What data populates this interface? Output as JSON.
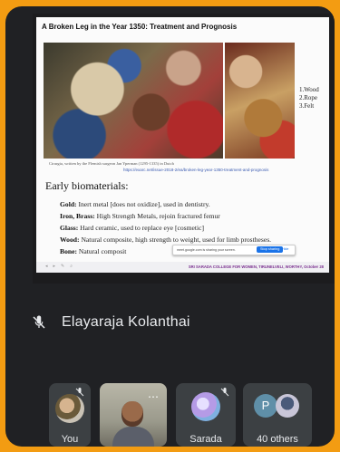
{
  "slide": {
    "title": "A Broken Leg in the Year 1350: Treatment and Prognosis",
    "legend": [
      "1.Wood",
      "2.Rope",
      "3.Felt"
    ],
    "caption": "Cirurgia, written by the Flemish surgeon Jan Yperman (1295-1335) in Dutch",
    "link": "https://exarc.net/issue-2018-2/ea/broken-leg-year-1350-treatment-and-prognosis",
    "heading": "Early biomaterials:",
    "materials": [
      {
        "name": "Gold:",
        "desc": "Inert metal [does not oxidize], used in dentistry."
      },
      {
        "name": "Iron, Brass:",
        "desc": "High Strength Metals, rejoin fractured femur"
      },
      {
        "name": "Glass:",
        "desc": "Hard ceramic, used to replace eye [cosmetic]"
      },
      {
        "name": "Wood:",
        "desc": "Natural composite, high strength to weight, used for limb prostheses."
      },
      {
        "name": "Bone:",
        "desc": "Natural composit"
      }
    ],
    "share_notice": "meet.google.com is sharing your screen.",
    "stop_sharing": "Stop sharing",
    "hide": "Hide",
    "footer": "SRI SARADA COLLEGE FOR WOMEN, TIRUNELVELI, WORTHY, October 28"
  },
  "presenter": {
    "name": "Elayaraja Kolanthai",
    "icon": "mic-off-icon"
  },
  "tiles": [
    {
      "label": "You",
      "icon": "mic-off-icon"
    },
    {
      "label": "",
      "icon": "more-options-icon"
    },
    {
      "label": "Sarada",
      "icon": "mic-off-icon"
    },
    {
      "label": "40 others",
      "avatar_letter": "P"
    }
  ],
  "colors": {
    "page_border": "#f39c12",
    "meet_background": "#202124",
    "tile_background": "#3c4043",
    "text_light": "#e8eaed",
    "avatar_p": "#5f8fa8"
  }
}
